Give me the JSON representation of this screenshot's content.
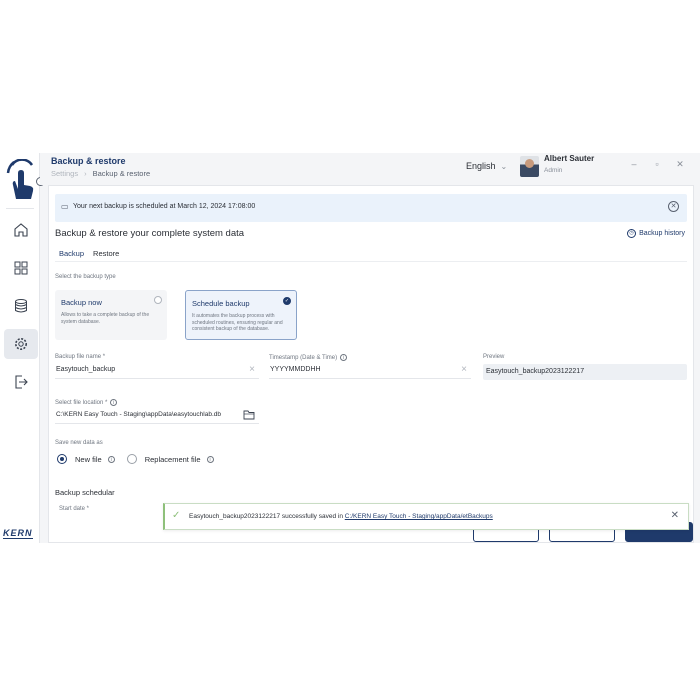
{
  "header": {
    "title": "Backup & restore",
    "breadcrumb": [
      "Settings",
      "Backup & restore"
    ],
    "language": "English",
    "user_name": "Albert Sauter",
    "user_role": "Admin"
  },
  "sidebar": {
    "items": [
      {
        "icon": "home-icon"
      },
      {
        "icon": "dashboard-icon"
      },
      {
        "icon": "database-icon"
      },
      {
        "icon": "settings-icon",
        "active": true
      },
      {
        "icon": "logout-icon"
      }
    ],
    "brand": "KERN"
  },
  "notice": {
    "text": "Your next backup is scheduled at March 12, 2024 17:08:00"
  },
  "main": {
    "section_title": "Backup & restore your complete system data",
    "history_label": "Backup history",
    "tabs": [
      {
        "label": "Backup",
        "active": true
      },
      {
        "label": "Restore",
        "active": false
      }
    ],
    "backup_type_label": "Select the backup type",
    "backup_types": [
      {
        "title": "Backup now",
        "desc": "Allows to take a complete backup of the system database.",
        "selected": false
      },
      {
        "title": "Schedule backup",
        "desc": "It automates the backup process with scheduled routines, ensuring regular and consistent backup of the database.",
        "selected": true
      }
    ],
    "file_name_label": "Backup file name *",
    "file_name_value": "Easytouch_backup",
    "timestamp_label": "Timestamp (Date & Time)",
    "timestamp_value": "YYYYMMDDHH",
    "preview_label": "Preview",
    "preview_value": "Easytouch_backup2023122217",
    "location_label": "Select file location *",
    "location_value": "C:\\KERN Easy Touch - Staging\\appData\\easytouchlab.db",
    "save_as_label": "Save new data as",
    "save_options": [
      {
        "label": "New file",
        "selected": true
      },
      {
        "label": "Replacement file",
        "selected": false
      }
    ],
    "scheduler_title": "Backup schedular",
    "start_date_label": "Start date *"
  },
  "toast": {
    "text": "Easytouch_backup2023122217 successfully saved in ",
    "link": "C:/KERN Easy Touch - Staging/appData/etBackups"
  },
  "colors": {
    "accent": "#1f3a6b",
    "success": "#8ec07a",
    "notice_bg": "#eaf2fb"
  }
}
